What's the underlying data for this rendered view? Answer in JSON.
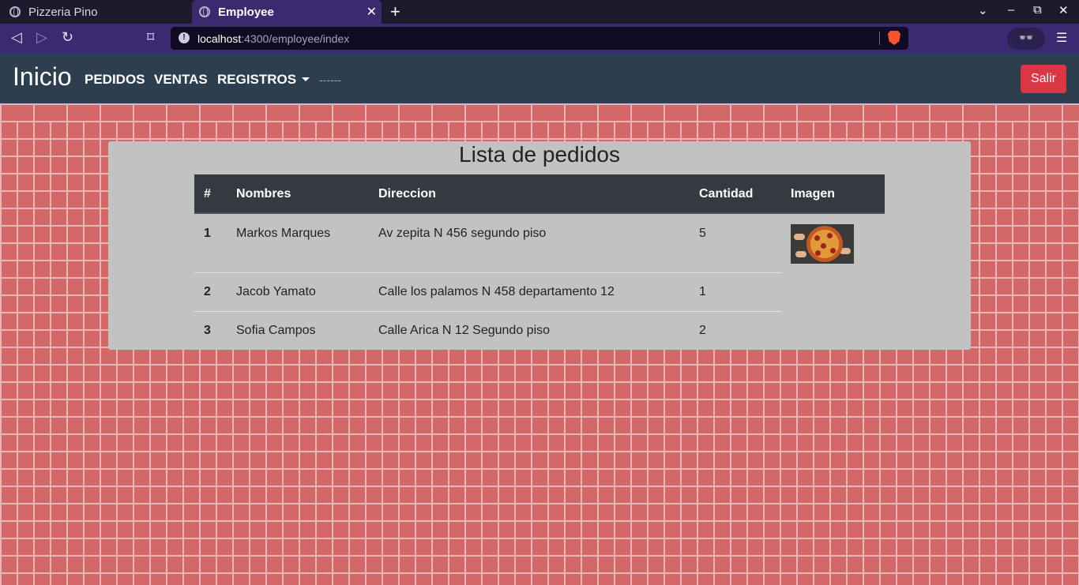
{
  "browser": {
    "tabs": [
      {
        "label": "Pizzeria Pino",
        "active": false
      },
      {
        "label": "Employee",
        "active": true
      }
    ],
    "new_tab": "+",
    "url_host": "localhost",
    "url_rest": ":4300/employee/index"
  },
  "navbar": {
    "brand": "Inicio",
    "links": [
      "PEDIDOS",
      "VENTAS",
      "REGISTROS"
    ],
    "dashes": "------",
    "logout_label": "Salir"
  },
  "main": {
    "title": "Lista de pedidos",
    "columns": [
      "#",
      "Nombres",
      "Direccion",
      "Cantidad",
      "Imagen"
    ],
    "rows": [
      {
        "num": "1",
        "name": "Markos Marques",
        "address": "Av zepita N 456 segundo piso",
        "qty": "5",
        "image": "pizza-photo"
      },
      {
        "num": "2",
        "name": "Jacob Yamato",
        "address": "Calle los palamos N 458 departamento 12",
        "qty": "1"
      },
      {
        "num": "3",
        "name": "Sofia Campos",
        "address": "Calle Arica N 12 Segundo piso",
        "qty": "2"
      }
    ]
  },
  "colors": {
    "navbar_bg": "#2d3f4f",
    "logout_bg": "#dc3545",
    "table_head_bg": "#343a40",
    "panel_bg": "#c2c2c2",
    "brick": "#d36868"
  }
}
